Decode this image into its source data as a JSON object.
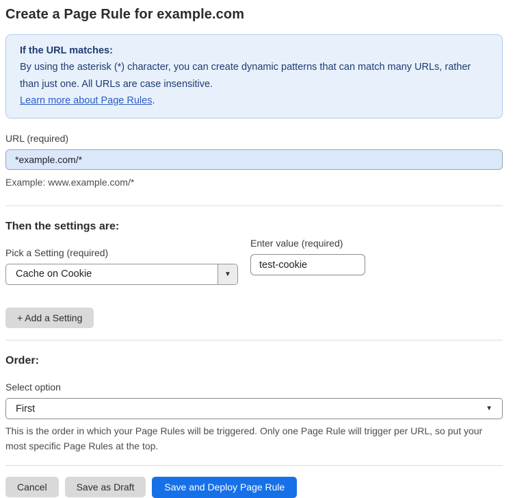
{
  "page": {
    "title": "Create a Page Rule for example.com"
  },
  "info_box": {
    "heading": "If the URL matches:",
    "body": "By using the asterisk (*) character, you can create dynamic patterns that can match many URLs, rather than just one. All URLs are case insensitive.",
    "link_label": "Learn more about Page Rules",
    "link_suffix": "."
  },
  "url_field": {
    "label": "URL (required)",
    "value": "*example.com/*",
    "helper": "Example: www.example.com/*"
  },
  "settings_section": {
    "heading": "Then the settings are:",
    "setting_label": "Pick a Setting (required)",
    "setting_value": "Cache on Cookie",
    "dropdown_arrow": "▼",
    "value_label": "Enter value (required)",
    "value_value": "test-cookie",
    "add_setting_label": "+ Add a Setting"
  },
  "order_section": {
    "heading": "Order:",
    "select_label": "Select option",
    "selected_option": "First",
    "select_arrow": "▼",
    "helper": "This is the order in which your Page Rules will be triggered. Only one Page Rule will trigger per URL, so put your most specific Page Rules at the top."
  },
  "footer": {
    "cancel_label": "Cancel",
    "save_draft_label": "Save as Draft",
    "save_deploy_label": "Save and Deploy Page Rule"
  },
  "colors": {
    "info_bg": "#e8f1fb",
    "info_border": "#aecbec",
    "info_text": "#1e3b70",
    "link": "#2b5cc4",
    "url_input_bg": "#dbe7fa",
    "primary_button": "#1671e8",
    "secondary_button": "#d9d9d9"
  }
}
